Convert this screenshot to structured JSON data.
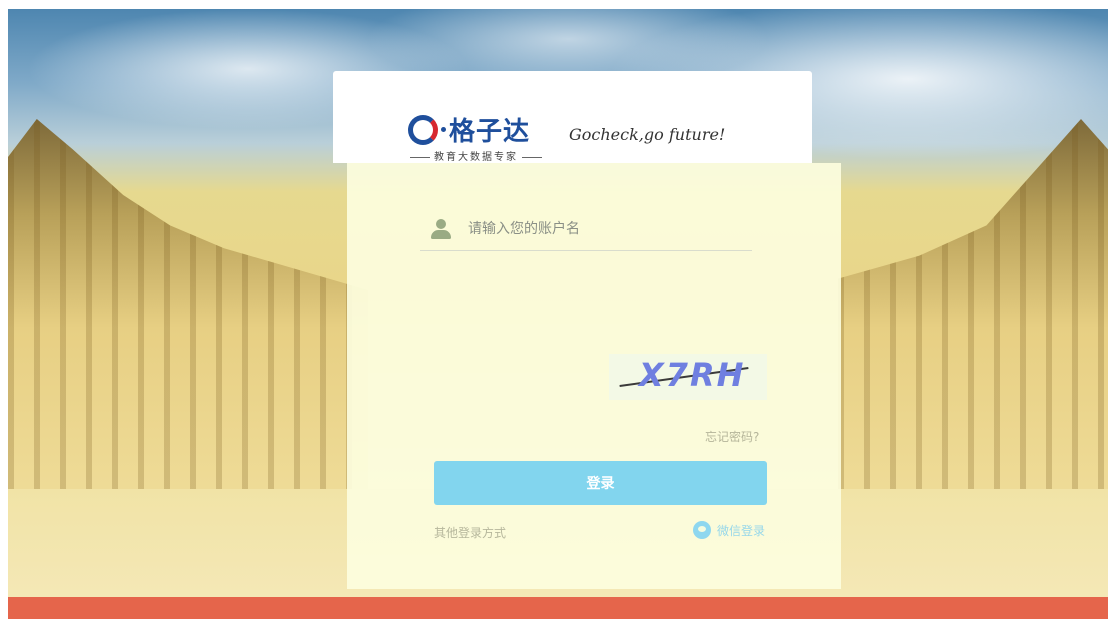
{
  "brand": {
    "name": "格子达",
    "subtitle": "教育大数据专家",
    "slogan": "Gocheck,go future!"
  },
  "login": {
    "username_placeholder": "请输入您的账户名",
    "captcha_text": "X7RH",
    "forgot_link": "忘记密码?",
    "submit_label": "登录",
    "other_login_label": "其他登录方式",
    "wechat_label": "微信登录"
  },
  "colors": {
    "brand_blue": "#1f4f9c",
    "brand_red": "#d7282f",
    "login_button": "#82d5ee"
  }
}
